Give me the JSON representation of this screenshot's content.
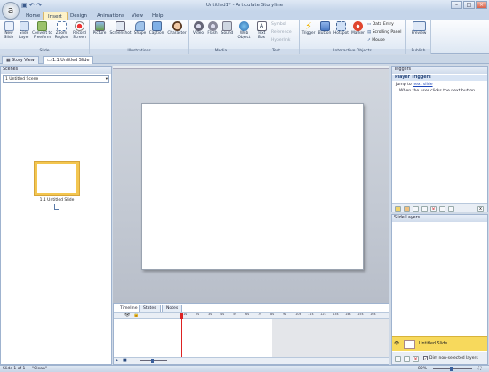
{
  "app": {
    "title": "Untitled1* - Articulate Storyline",
    "logo": "a"
  },
  "quick_access": [
    "save-icon",
    "undo-icon",
    "redo-icon"
  ],
  "tabs": [
    {
      "label": "Home"
    },
    {
      "label": "Insert"
    },
    {
      "label": "Design"
    },
    {
      "label": "Animations"
    },
    {
      "label": "View"
    },
    {
      "label": "Help"
    }
  ],
  "ribbon": {
    "slide": {
      "label": "Slide",
      "buttons": [
        "New Slide",
        "Slide Layer",
        "Convert to Freeform",
        "Zoom Region",
        "Record Screen"
      ]
    },
    "illustrations": {
      "label": "Illustrations",
      "buttons": [
        "Picture",
        "Screenshot",
        "Shape",
        "Caption",
        "Character"
      ]
    },
    "media": {
      "label": "Media",
      "buttons": [
        "Video",
        "Flash",
        "Sound",
        "Web Object"
      ]
    },
    "text": {
      "label": "Text",
      "buttons": [
        "Text Box"
      ],
      "small": [
        "Symbol",
        "Reference",
        "Hyperlink"
      ]
    },
    "interactive": {
      "label": "Interactive Objects",
      "buttons": [
        "Trigger",
        "Button",
        "Hotspot",
        "Marker"
      ],
      "small": [
        "Data Entry",
        "Scrolling Panel",
        "Mouse"
      ]
    },
    "publish": {
      "label": "Publish",
      "buttons": [
        "Preview"
      ]
    }
  },
  "doc_tabs": [
    {
      "label": "Story View"
    },
    {
      "label": "1.1 Untitled Slide"
    }
  ],
  "scenes": {
    "header": "Scenes",
    "selected": "1 Untitled Scene",
    "slide_label": "1.1 Untitled Slide"
  },
  "timeline": {
    "tabs": [
      "Timeline",
      "States",
      "Notes"
    ],
    "ticks": [
      "1s",
      "2s",
      "3s",
      "4s",
      "5s",
      "6s",
      "7s",
      "8s",
      "9s",
      "10s",
      "11s",
      "12s",
      "13s",
      "14s",
      "15s",
      "16s"
    ]
  },
  "triggers": {
    "header": "Triggers",
    "title": "Player Triggers",
    "line1_prefix": "Jump to",
    "line1_link": "next slide",
    "line2": "When the user clicks the next button"
  },
  "layers": {
    "header": "Slide Layers",
    "base_layer": "Untitled Slide",
    "dim_label": "Dim non-selected layers"
  },
  "status": {
    "slide": "Slide 1 of 1",
    "state": "\"Clean\"",
    "zoom": "80%"
  },
  "colors": {
    "accent": "#f7d95c",
    "ribbon": "#dde7f3",
    "link": "#1a44b8"
  }
}
